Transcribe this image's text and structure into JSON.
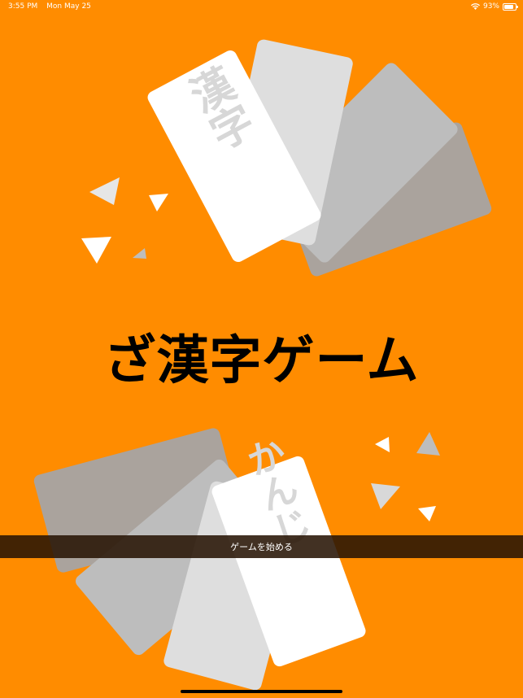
{
  "status_bar": {
    "time": "3:55 PM",
    "date": "Mon May 25",
    "battery": "93%",
    "icons": [
      "wifi-icon",
      "battery-icon"
    ]
  },
  "top_card": {
    "text": "漢字"
  },
  "bottom_card": {
    "text": "かんじ"
  },
  "title": "ざ漢字ゲーム",
  "start_button": {
    "label": "ゲームを始める"
  },
  "colors": {
    "background": "#FF8C00",
    "title": "#000000",
    "banner": "#281405"
  }
}
